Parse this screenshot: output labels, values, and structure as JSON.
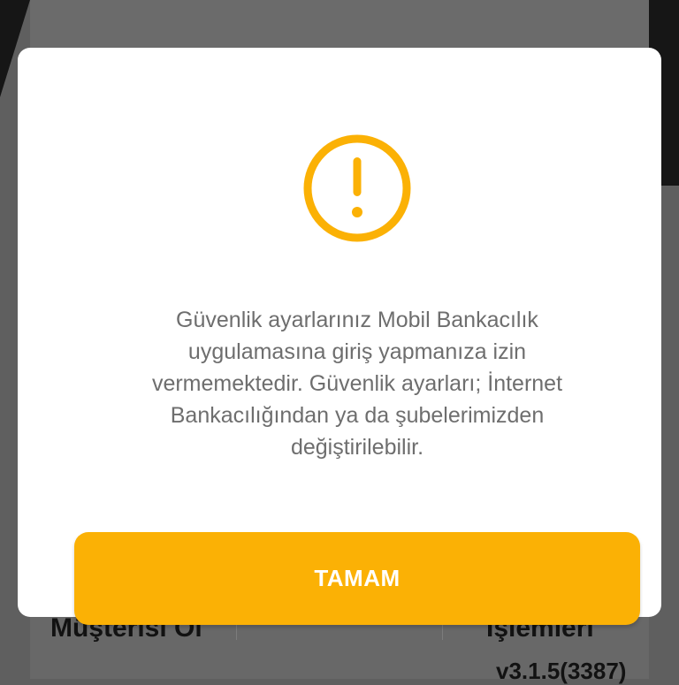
{
  "background": {
    "left_item": "Müşterisi Ol",
    "right_item": "İşlemleri",
    "version": "v3.1.5(3387)"
  },
  "dialog": {
    "icon": "exclamation-circle-icon",
    "accent_color": "#fbb105",
    "message": "Güvenlik ayarlarınız Mobil Bankacılık uygulamasına giriş yapmanıza izin vermemektedir. Güvenlik ayarları; İnternet Bankacılığından ya da şubelerimizden değiştirilebilir.",
    "ok_label": "TAMAM"
  }
}
